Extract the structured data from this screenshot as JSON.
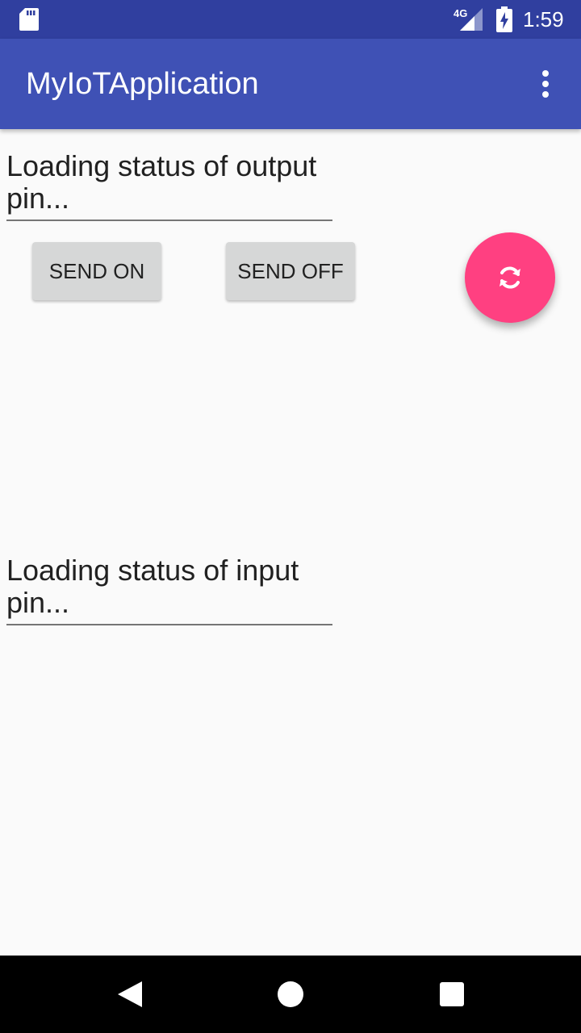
{
  "status_bar": {
    "network": "4G",
    "time": "1:59",
    "icons": [
      "sd-card-icon",
      "signal-icon",
      "battery-icon"
    ]
  },
  "app_bar": {
    "title": "MyIoTApplication",
    "menu_icon": "overflow-menu-icon"
  },
  "main": {
    "output_status": "Loading status of output pin...",
    "send_on_label": "SEND ON",
    "send_off_label": "SEND OFF",
    "input_status": "Loading status of input pin...",
    "fab_icon": "refresh-icon"
  },
  "nav_bar": {
    "icons": [
      "back-icon",
      "home-icon",
      "recents-icon"
    ]
  },
  "colors": {
    "status_bar": "#303f9f",
    "app_bar": "#3f51b5",
    "fab": "#ff4081",
    "button": "#d6d7d7",
    "background": "#fafafa"
  }
}
